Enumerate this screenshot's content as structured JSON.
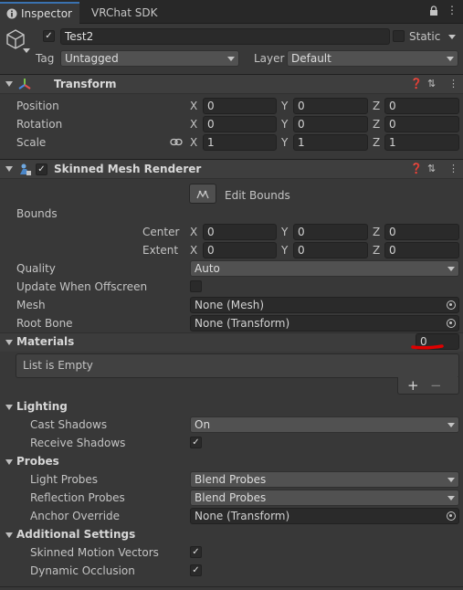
{
  "tabs": [
    {
      "label": "Inspector",
      "icon": "info-icon"
    },
    {
      "label": "VRChat SDK"
    }
  ],
  "gameobject": {
    "name": "Test2",
    "active": true,
    "static_label": "Static",
    "tag_label": "Tag",
    "tag_value": "Untagged",
    "layer_label": "Layer",
    "layer_value": "Default"
  },
  "transform": {
    "title": "Transform",
    "rows": [
      {
        "label": "Position",
        "x": "0",
        "y": "0",
        "z": "0"
      },
      {
        "label": "Rotation",
        "x": "0",
        "y": "0",
        "z": "0"
      },
      {
        "label": "Scale",
        "x": "1",
        "y": "1",
        "z": "1"
      }
    ]
  },
  "axes": {
    "x": "X",
    "y": "Y",
    "z": "Z"
  },
  "smr": {
    "title": "Skinned Mesh Renderer",
    "enabled": true,
    "edit_bounds": "Edit Bounds",
    "bounds_label": "Bounds",
    "center": {
      "label": "Center",
      "x": "0",
      "y": "0",
      "z": "0"
    },
    "extent": {
      "label": "Extent",
      "x": "0",
      "y": "0",
      "z": "0"
    },
    "quality_label": "Quality",
    "quality_value": "Auto",
    "update_offscreen_label": "Update When Offscreen",
    "mesh_label": "Mesh",
    "mesh_value": "None (Mesh)",
    "root_bone_label": "Root Bone",
    "root_bone_value": "None (Transform)",
    "materials_label": "Materials",
    "materials_count": "0",
    "list_empty": "List is Empty",
    "add_symbol": "+",
    "remove_symbol": "−",
    "lighting_label": "Lighting",
    "cast_shadows_label": "Cast Shadows",
    "cast_shadows_value": "On",
    "receive_shadows_label": "Receive Shadows",
    "probes_label": "Probes",
    "light_probes_label": "Light Probes",
    "light_probes_value": "Blend Probes",
    "reflection_probes_label": "Reflection Probes",
    "reflection_probes_value": "Blend Probes",
    "anchor_override_label": "Anchor Override",
    "anchor_override_value": "None (Transform)",
    "additional_label": "Additional Settings",
    "motion_vectors_label": "Skinned Motion Vectors",
    "dynamic_occlusion_label": "Dynamic Occlusion"
  },
  "colors": {
    "annotation": "#e00000"
  }
}
